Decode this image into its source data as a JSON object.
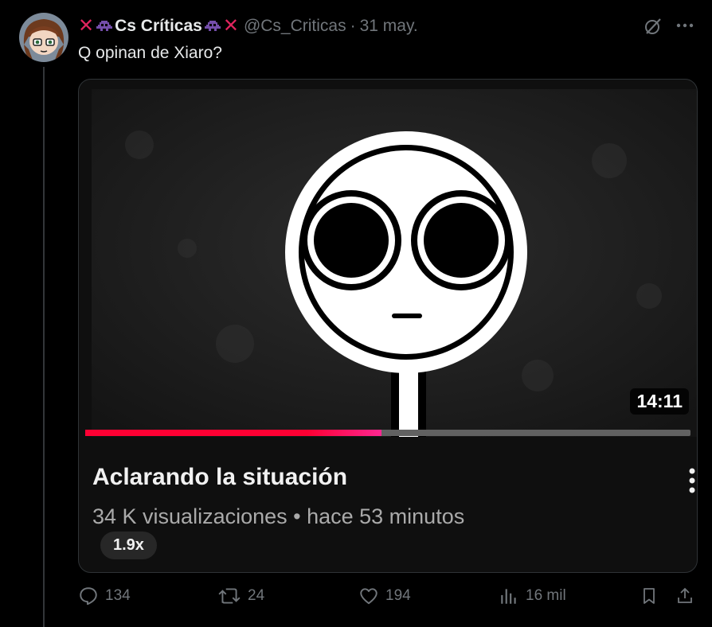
{
  "tweet": {
    "display_name": "Cs Críticas",
    "handle": "@Cs_Criticas",
    "separator": "·",
    "date": "31 may.",
    "text": "Q opinan de Xiaro?"
  },
  "video_card": {
    "title": "Aclarando la situación",
    "meta": "34 K visualizaciones • hace 53 minutos",
    "duration": "14:11",
    "speed": "1.9x",
    "progress_fraction": 0.49
  },
  "actions": {
    "replies": "134",
    "retweets": "24",
    "likes": "194",
    "views": "16 mil"
  },
  "icons": {
    "grok": "grok-icon",
    "more": "more-icon",
    "reply": "reply-icon",
    "retweet": "retweet-icon",
    "like": "heart-icon",
    "views": "views-icon",
    "bookmark": "bookmark-icon",
    "share": "share-icon"
  },
  "colors": {
    "background": "#000000",
    "text": "#e7e9ea",
    "muted": "#71767b",
    "emoji_x": "#e0245e",
    "emoji_alien": "#744eaa",
    "progress": "#ff0033"
  }
}
